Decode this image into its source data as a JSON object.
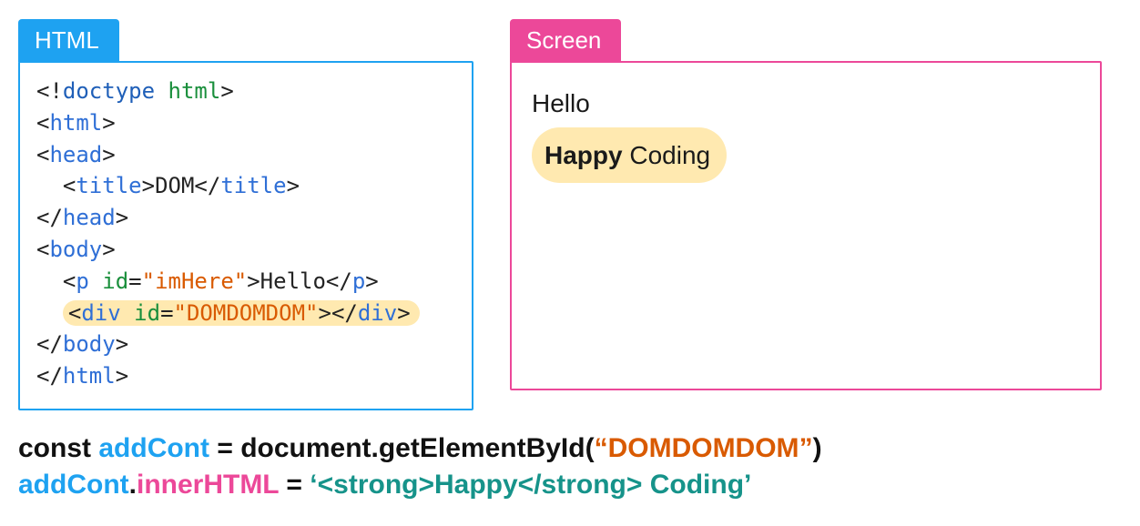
{
  "tabs": {
    "html": "HTML",
    "screen": "Screen"
  },
  "code": {
    "l1_a": "<!",
    "l1_b": "doctype",
    "l1_c": " ",
    "l1_d": "html",
    "l1_e": ">",
    "l2_a": "<",
    "l2_b": "html",
    "l2_c": ">",
    "l3_a": "<",
    "l3_b": "head",
    "l3_c": ">",
    "l4_pad": "  ",
    "l4_a": "<",
    "l4_b": "title",
    "l4_c": ">",
    "l4_d": "DOM",
    "l4_e": "</",
    "l4_f": "title",
    "l4_g": ">",
    "l5_a": "</",
    "l5_b": "head",
    "l5_c": ">",
    "l6_a": "<",
    "l6_b": "body",
    "l6_c": ">",
    "l7_pad": "  ",
    "l7_a": "<",
    "l7_b": "p",
    "l7_c": " ",
    "l7_d": "id",
    "l7_e": "=",
    "l7_f": "\"imHere\"",
    "l7_g": ">",
    "l7_h": "Hello",
    "l7_i": "</",
    "l7_j": "p",
    "l7_k": ">",
    "l8_pad": "  ",
    "l8_a": "<",
    "l8_b": "div",
    "l8_c": " ",
    "l8_d": "id",
    "l8_e": "=",
    "l8_f": "\"DOMDOMDOM\"",
    "l8_g": ">",
    "l8_h": "</",
    "l8_i": "div",
    "l8_j": ">",
    "l9_a": "</",
    "l9_b": "body",
    "l9_c": ">",
    "l10_a": "</",
    "l10_b": "html",
    "l10_c": ">"
  },
  "screen": {
    "line1": "Hello",
    "line2_strong": "Happy",
    "line2_rest": " Coding"
  },
  "bottom": {
    "l1_const": "const ",
    "l1_var": "addCont",
    "l1_eq": " = document.getElementById(",
    "l1_q1": "“",
    "l1_arg": "DOMDOMDOM",
    "l1_q2": "”",
    "l1_close": ")",
    "l2_var": "addCont",
    "l2_dot": ".",
    "l2_prop": "innerHTML",
    "l2_eq": " = ",
    "l2_val": "‘<strong>Happy</strong> Coding’"
  }
}
